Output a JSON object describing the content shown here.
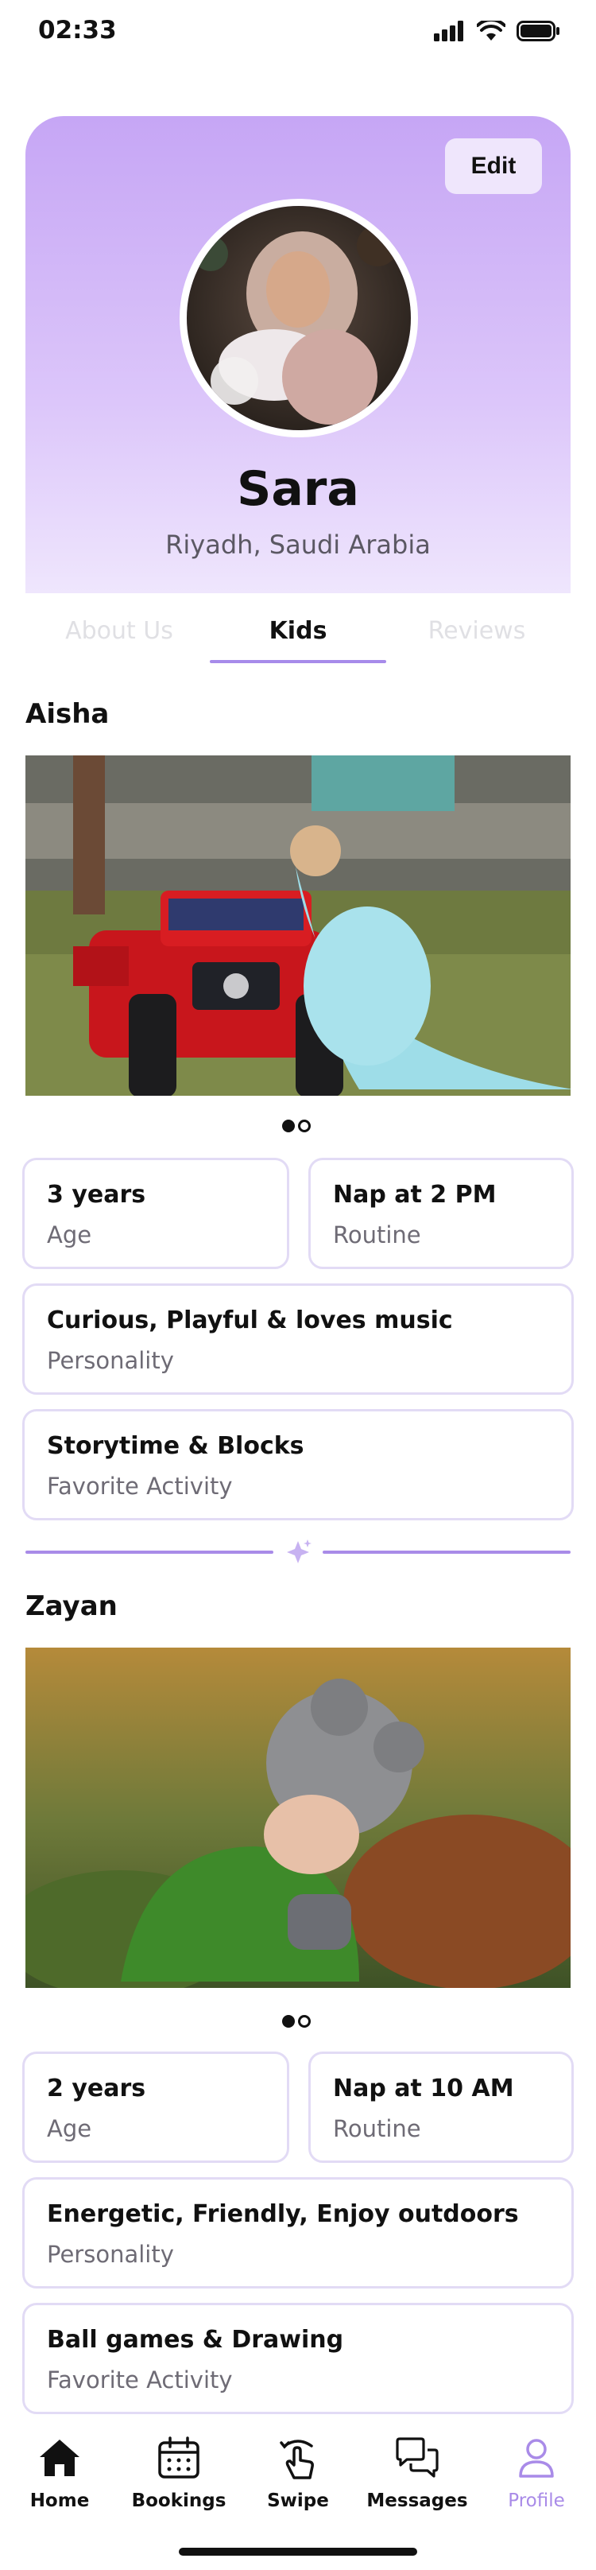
{
  "status_bar": {
    "time": "02:33"
  },
  "profile": {
    "edit_label": "Edit",
    "name": "Sara",
    "location": "Riyadh, Saudi Arabia"
  },
  "tabs": [
    {
      "label": "About Us",
      "active": false
    },
    {
      "label": "Kids",
      "active": true
    },
    {
      "label": "Reviews",
      "active": false
    }
  ],
  "kids": [
    {
      "name": "Aisha",
      "photo_pages": 2,
      "photo_current": 1,
      "age": {
        "value": "3 years",
        "label": "Age"
      },
      "routine": {
        "value": "Nap at 2 PM",
        "label": "Routine"
      },
      "personality": {
        "value": "Curious, Playful & loves music",
        "label": "Personality"
      },
      "favorite": {
        "value": "Storytime & Blocks",
        "label": "Favorite Activity"
      }
    },
    {
      "name": "Zayan",
      "photo_pages": 2,
      "photo_current": 1,
      "age": {
        "value": "2 years",
        "label": "Age"
      },
      "routine": {
        "value": "Nap at 10 AM",
        "label": "Routine"
      },
      "personality": {
        "value": "Energetic, Friendly, Enjoy outdoors",
        "label": "Personality"
      },
      "favorite": {
        "value": "Ball games & Drawing",
        "label": "Favorite Activity"
      }
    }
  ],
  "bottom_nav": [
    {
      "label": "Home",
      "icon": "home-icon",
      "active": false
    },
    {
      "label": "Bookings",
      "icon": "calendar-icon",
      "active": false
    },
    {
      "label": "Swipe",
      "icon": "swipe-hand-icon",
      "active": false
    },
    {
      "label": "Messages",
      "icon": "chat-bubbles-icon",
      "active": false
    },
    {
      "label": "Profile",
      "icon": "user-icon",
      "active": true
    }
  ],
  "colors": {
    "accent": "#a98be8",
    "card_gradient_top": "#c6a6f5",
    "card_border": "#e2dbf5"
  }
}
